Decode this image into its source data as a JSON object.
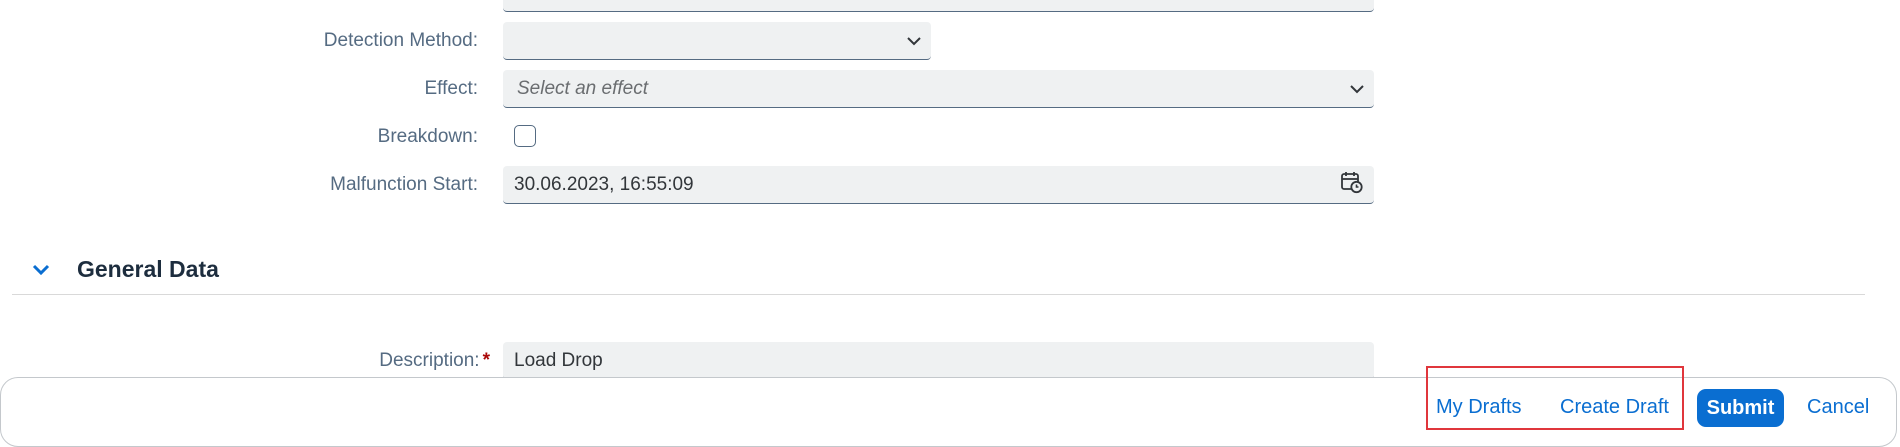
{
  "form": {
    "detection_method": {
      "label": "Detection Method:",
      "value": ""
    },
    "effect": {
      "label": "Effect:",
      "placeholder": "Select an effect"
    },
    "breakdown": {
      "label": "Breakdown:",
      "checked": false
    },
    "malfunction_start": {
      "label": "Malfunction Start:",
      "value": "30.06.2023, 16:55:09"
    }
  },
  "general_data": {
    "title": "General Data",
    "description": {
      "label": "Description:",
      "required_mark": "*",
      "value": "Load Drop"
    }
  },
  "footer": {
    "my_drafts": "My Drafts",
    "create_draft": "Create Draft",
    "submit": "Submit",
    "cancel": "Cancel"
  }
}
